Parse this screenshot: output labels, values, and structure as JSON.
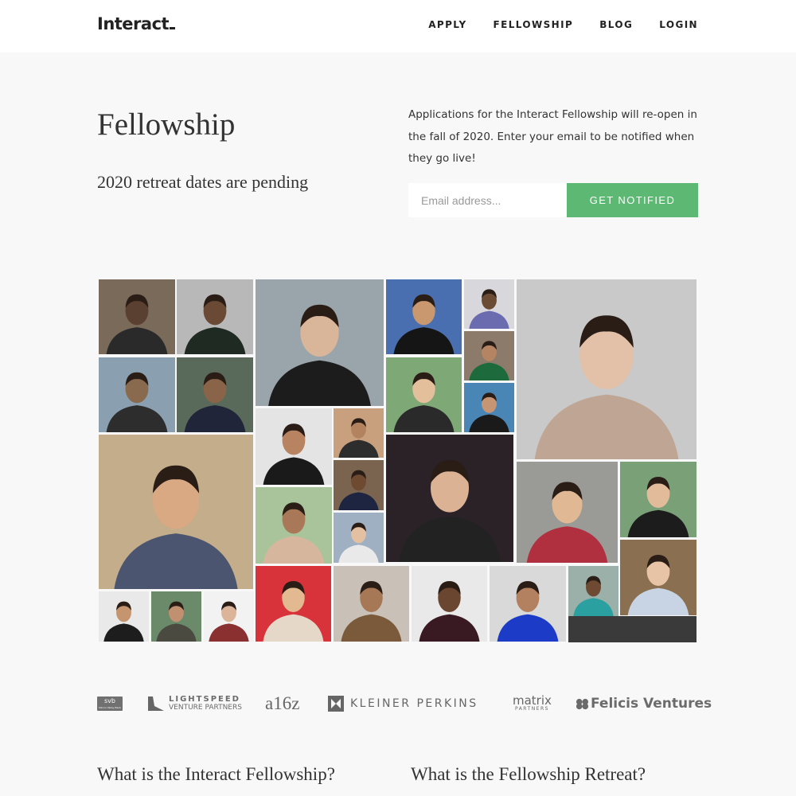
{
  "header": {
    "logo": "Interact",
    "nav": [
      "APPLY",
      "FELLOWSHIP",
      "BLOG",
      "LOGIN"
    ]
  },
  "hero": {
    "title": "Fellowship",
    "subtitle": "2020 retreat dates are pending",
    "description": "Applications for the Interact Fellowship will re-open in the fall of 2020. Enter your email to be notified when they go live!",
    "email_placeholder": "Email address...",
    "button_label": "GET NOTIFIED",
    "accent_color": "#5cb873"
  },
  "investors": {
    "svb": {
      "mark": "svb",
      "tagline": "Silicon Valley Bank"
    },
    "lightspeed": {
      "name": "LIGHTSPEED",
      "sub": "VENTURE PARTNERS"
    },
    "a16z": "a16z",
    "kleiner": "KLEINER PERKINS",
    "matrix": {
      "name": "matrix",
      "sub": "PARTNERS"
    },
    "felicis": "Felicis Ventures"
  },
  "sections": [
    {
      "heading": "What is the Interact Fellowship?"
    },
    {
      "heading": "What is the Fellowship Retreat?"
    }
  ]
}
